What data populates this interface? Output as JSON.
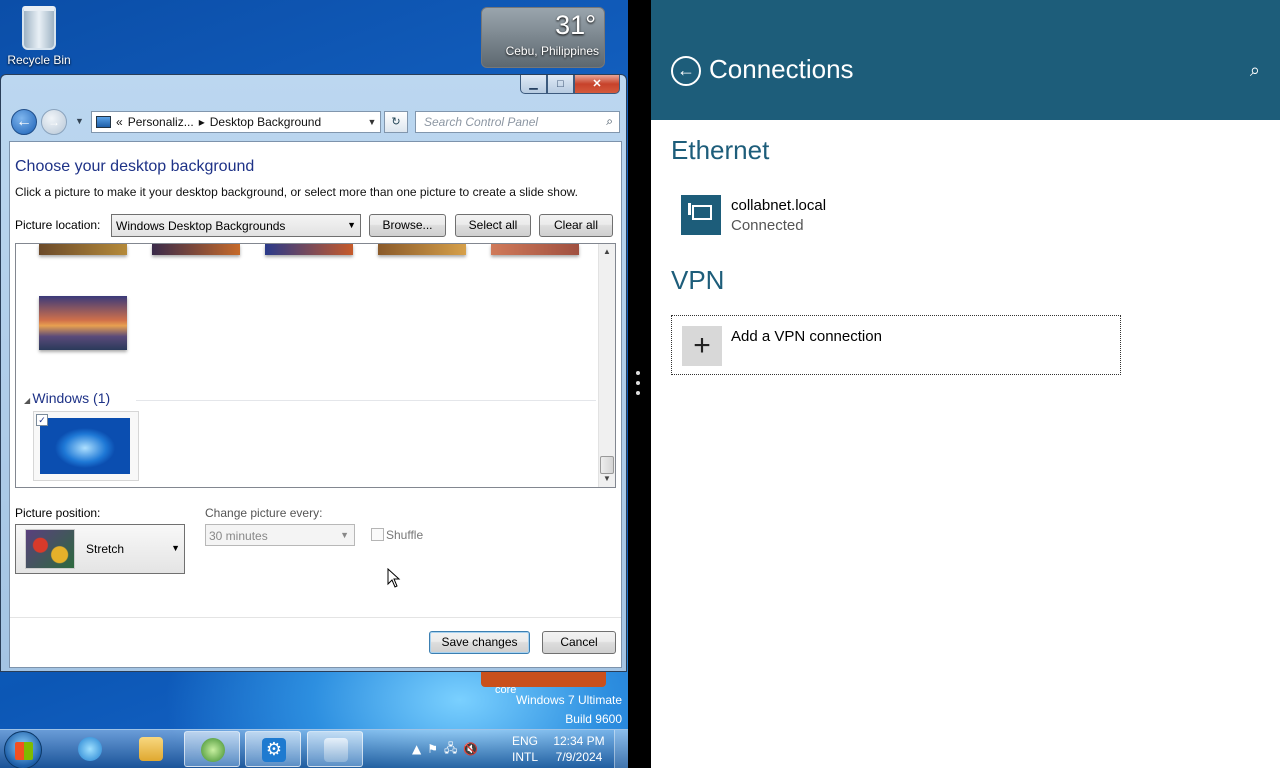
{
  "desktop": {
    "recycle_bin": "Recycle Bin",
    "weather": {
      "temp": "31°",
      "city": "Cebu, Philippines"
    },
    "watermark": {
      "core": "core",
      "edition": "Windows 7 Ultimate",
      "build": "Build 9600"
    }
  },
  "window": {
    "caption_buttons": {
      "minimize": "▁",
      "maximize": "□",
      "close": "✕"
    },
    "address": {
      "chevrons": "«",
      "crumb1": "Personaliz...",
      "sep": "▸",
      "crumb2": "Desktop Background"
    },
    "search": {
      "placeholder": "Search Control Panel"
    },
    "title": "Choose your desktop background",
    "description": "Click a picture to make it your desktop background, or select more than one picture to create a slide show.",
    "picture_location": {
      "label": "Picture location:",
      "value": "Windows Desktop Backgrounds"
    },
    "buttons": {
      "browse": "Browse...",
      "select_all": "Select all",
      "clear_all": "Clear all",
      "save": "Save changes",
      "cancel": "Cancel"
    },
    "group": {
      "label": "Windows (1)"
    },
    "picture_position": {
      "label": "Picture position:",
      "value": "Stretch"
    },
    "change_every": {
      "label": "Change picture every:",
      "value": "30 minutes"
    },
    "shuffle": {
      "label": "Shuffle",
      "checked": false
    }
  },
  "taskbar": {
    "lang": "ENG",
    "kbd": "INTL",
    "time": "12:34 PM",
    "date": "7/9/2024"
  },
  "connections": {
    "title": "Connections",
    "ethernet": {
      "heading": "Ethernet",
      "name": "collabnet.local",
      "status": "Connected"
    },
    "vpn": {
      "heading": "VPN",
      "add_label": "Add a VPN connection"
    }
  },
  "colors": {
    "metro_accent": "#1d5d7a",
    "link_blue": "#1e3287"
  }
}
